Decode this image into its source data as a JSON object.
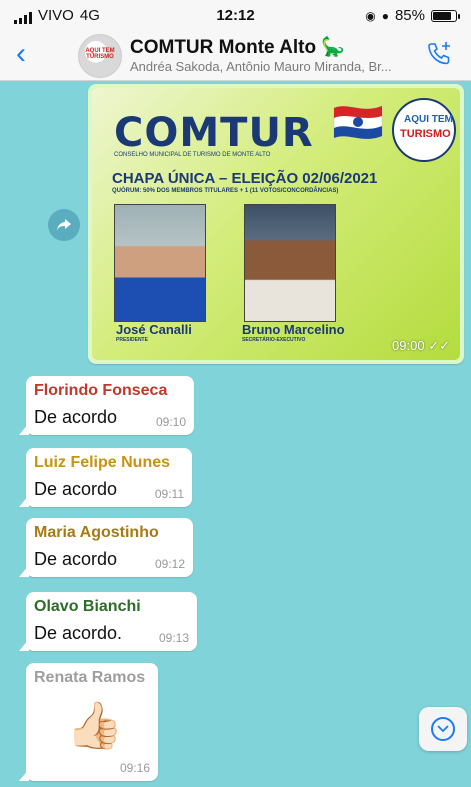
{
  "status_bar": {
    "carrier": "VIVO",
    "network": "4G",
    "time": "12:12",
    "battery": "85%",
    "battery_level": 0.85
  },
  "header": {
    "back_icon": "chevron-left-icon",
    "title": "COMTUR Monte Alto",
    "title_emoji": "🦕",
    "subtitle": "Andréa Sakoda, Antônio Mauro Miranda, Br...",
    "call_icon": "add-call-icon",
    "avatar_label": "AQUI TEM TURISMO"
  },
  "image_message": {
    "logo": "COMTUR",
    "logo_sub": "CONSELHO MUNICIPAL DE TURISMO DE MONTE ALTO",
    "seal_top": "AQUI TEM",
    "seal_bottom": "TURISMO",
    "title": "CHAPA ÚNICA – ELEIÇÃO 02/06/2021",
    "subtitle": "QUÓRUM: 50% DOS MEMBROS TITULARES + 1 (11 VOTOS/CONCORDÂNCIAS)",
    "candidates": [
      {
        "name": "José Canalli",
        "role": "PRESIDENTE"
      },
      {
        "name": "Bruno Marcelino",
        "role": "SECRETÁRIO-EXECUTIVO"
      }
    ],
    "time": "09:00",
    "read_icon": "double-check-icon"
  },
  "messages": [
    {
      "sender": "Florindo Fonseca",
      "sender_color": "#c0392b",
      "text": "De acordo",
      "time": "09:10"
    },
    {
      "sender": "Luiz Felipe Nunes",
      "sender_color": "#c79412",
      "text": "De acordo",
      "time": "09:11"
    },
    {
      "sender": "Maria Agostinho",
      "sender_color": "#a87a12",
      "text": "De acordo",
      "time": "09:12"
    },
    {
      "sender": "Olavo Bianchi",
      "sender_color": "#2e6b2a",
      "text": "De acordo.",
      "time": "09:13"
    },
    {
      "sender": "Renata Ramos",
      "sender_color": "#9e9e9e",
      "text": "👍🏻",
      "time": "09:16"
    }
  ],
  "colors": {
    "accent": "#1a7cf5",
    "chat_bg": "#7fd3d9",
    "outgoing": "#dcf8c6"
  }
}
